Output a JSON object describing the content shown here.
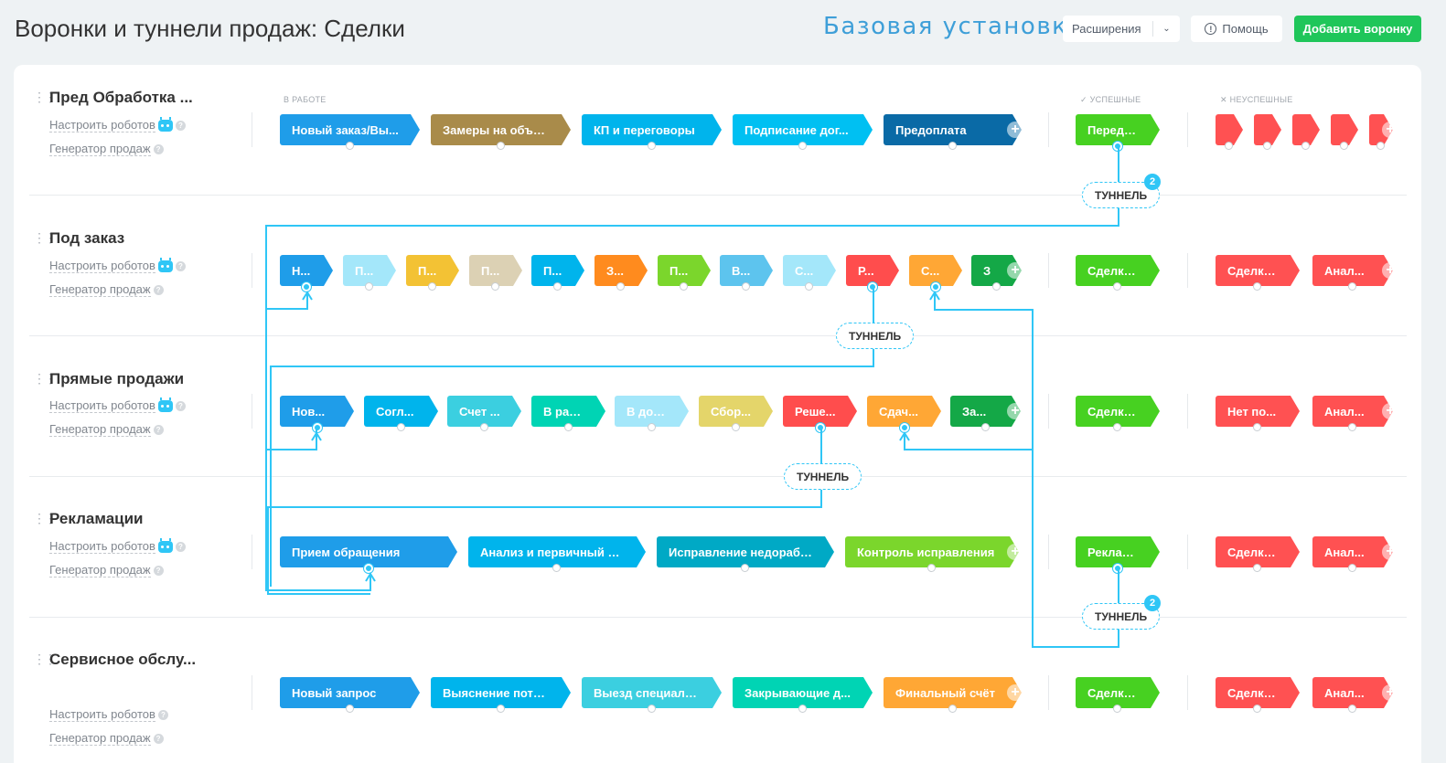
{
  "header": {
    "title": "Воронки и туннели продаж: Сделки",
    "watermark": "Базовая установка",
    "extensions_label": "Расширения",
    "help_label": "Помощь",
    "add_funnel_label": "Добавить воронку"
  },
  "columns": {
    "in_work": "В РАБОТЕ",
    "success": "УСПЕШНЫЕ",
    "fail": "НЕУСПЕШНЫЕ"
  },
  "links": {
    "robots": "Настроить роботов",
    "generator": "Генератор продаж"
  },
  "tunnel_label": "ТУННЕЛЬ",
  "tunnels": [
    {
      "label": "ТУННЕЛЬ",
      "count": "2"
    },
    {
      "label": "ТУННЕЛЬ",
      "count": ""
    },
    {
      "label": "ТУННЕЛЬ",
      "count": ""
    },
    {
      "label": "ТУННЕЛЬ",
      "count": "2"
    }
  ],
  "funnels": [
    {
      "name": "Пред Обработка ...",
      "stages": [
        {
          "label": "Новый заказ/Вы...",
          "color": "#1f9de9"
        },
        {
          "label": "Замеры на объек...",
          "color": "#a98b4a"
        },
        {
          "label": "КП и переговоры",
          "color": "#00b4ec"
        },
        {
          "label": "Подписание дог...",
          "color": "#00c0f2"
        },
        {
          "label": "Предоплата",
          "color": "#0a6aa6"
        }
      ],
      "success": [
        {
          "label": "Передач...",
          "color": "#47d121"
        }
      ],
      "fail": [
        {
          "label": "",
          "color": "#ff5152"
        },
        {
          "label": "",
          "color": "#ff5152"
        },
        {
          "label": "",
          "color": "#ff5152"
        },
        {
          "label": "",
          "color": "#ff5152"
        },
        {
          "label": "",
          "color": "#ff5152"
        }
      ]
    },
    {
      "name": "Под заказ",
      "stages": [
        {
          "label": "Н...",
          "color": "#1f9de9"
        },
        {
          "label": "П...",
          "color": "#a4e7fa"
        },
        {
          "label": "П...",
          "color": "#f3c234"
        },
        {
          "label": "П...",
          "color": "#dcd1b4"
        },
        {
          "label": "П...",
          "color": "#00b4ec"
        },
        {
          "label": "З...",
          "color": "#ff8b1e"
        },
        {
          "label": "П...",
          "color": "#7bd62c"
        },
        {
          "label": "В...",
          "color": "#5dc4ee"
        },
        {
          "label": "С...",
          "color": "#a4e7fa"
        },
        {
          "label": "Р...",
          "color": "#ff4d4d"
        },
        {
          "label": "С...",
          "color": "#ffa735"
        },
        {
          "label": "З",
          "color": "#14a847"
        }
      ],
      "success": [
        {
          "label": "Сделка ...",
          "color": "#47d121"
        }
      ],
      "fail": [
        {
          "label": "Сделка ...",
          "color": "#ff5152"
        },
        {
          "label": "Анал...",
          "color": "#ff5152"
        }
      ]
    },
    {
      "name": "Прямые продажи",
      "stages": [
        {
          "label": "Нов...",
          "color": "#1f9de9"
        },
        {
          "label": "Согл...",
          "color": "#00b4ec"
        },
        {
          "label": "Счет ...",
          "color": "#3bcfe0"
        },
        {
          "label": "В раб...",
          "color": "#00d4b4"
        },
        {
          "label": "В дос...",
          "color": "#a4e7fa"
        },
        {
          "label": "Сбор...",
          "color": "#e4d56a"
        },
        {
          "label": "Реше...",
          "color": "#ff4d4d"
        },
        {
          "label": "Сдач...",
          "color": "#ffa735"
        },
        {
          "label": "За...",
          "color": "#14a847"
        }
      ],
      "success": [
        {
          "label": "Сделка ...",
          "color": "#47d121"
        }
      ],
      "fail": [
        {
          "label": "Нет по...",
          "color": "#ff5152"
        },
        {
          "label": "Анал...",
          "color": "#ff5152"
        }
      ]
    },
    {
      "name": "Рекламации",
      "stages": [
        {
          "label": "Прием обращения",
          "color": "#1f9de9"
        },
        {
          "label": "Анализ и первичный от...",
          "color": "#00b4ec"
        },
        {
          "label": "Исправление недорабо...",
          "color": "#00a9c5"
        },
        {
          "label": "Контроль исправления",
          "color": "#7bd62c"
        }
      ],
      "success": [
        {
          "label": "Реклама...",
          "color": "#47d121"
        }
      ],
      "fail": [
        {
          "label": "Сделка ...",
          "color": "#ff5152"
        },
        {
          "label": "Анал...",
          "color": "#ff5152"
        }
      ]
    },
    {
      "name": "Сервисное обслу...",
      "stages": [
        {
          "label": "Новый запрос",
          "color": "#1f9de9"
        },
        {
          "label": "Выяснение потр...",
          "color": "#00b4ec"
        },
        {
          "label": "Выезд специалис...",
          "color": "#3bcfe0"
        },
        {
          "label": "Закрывающие д...",
          "color": "#00d4b4"
        },
        {
          "label": "Финальный счёт",
          "color": "#ffa735"
        }
      ],
      "success": [
        {
          "label": "Сделка ...",
          "color": "#47d121"
        }
      ],
      "fail": [
        {
          "label": "Сделка ...",
          "color": "#ff5152"
        },
        {
          "label": "Анал...",
          "color": "#ff5152"
        }
      ]
    }
  ],
  "colors": {
    "accent": "#2fc6f6",
    "add_button": "#1fc65a",
    "watermark": "#3e9fd8"
  }
}
